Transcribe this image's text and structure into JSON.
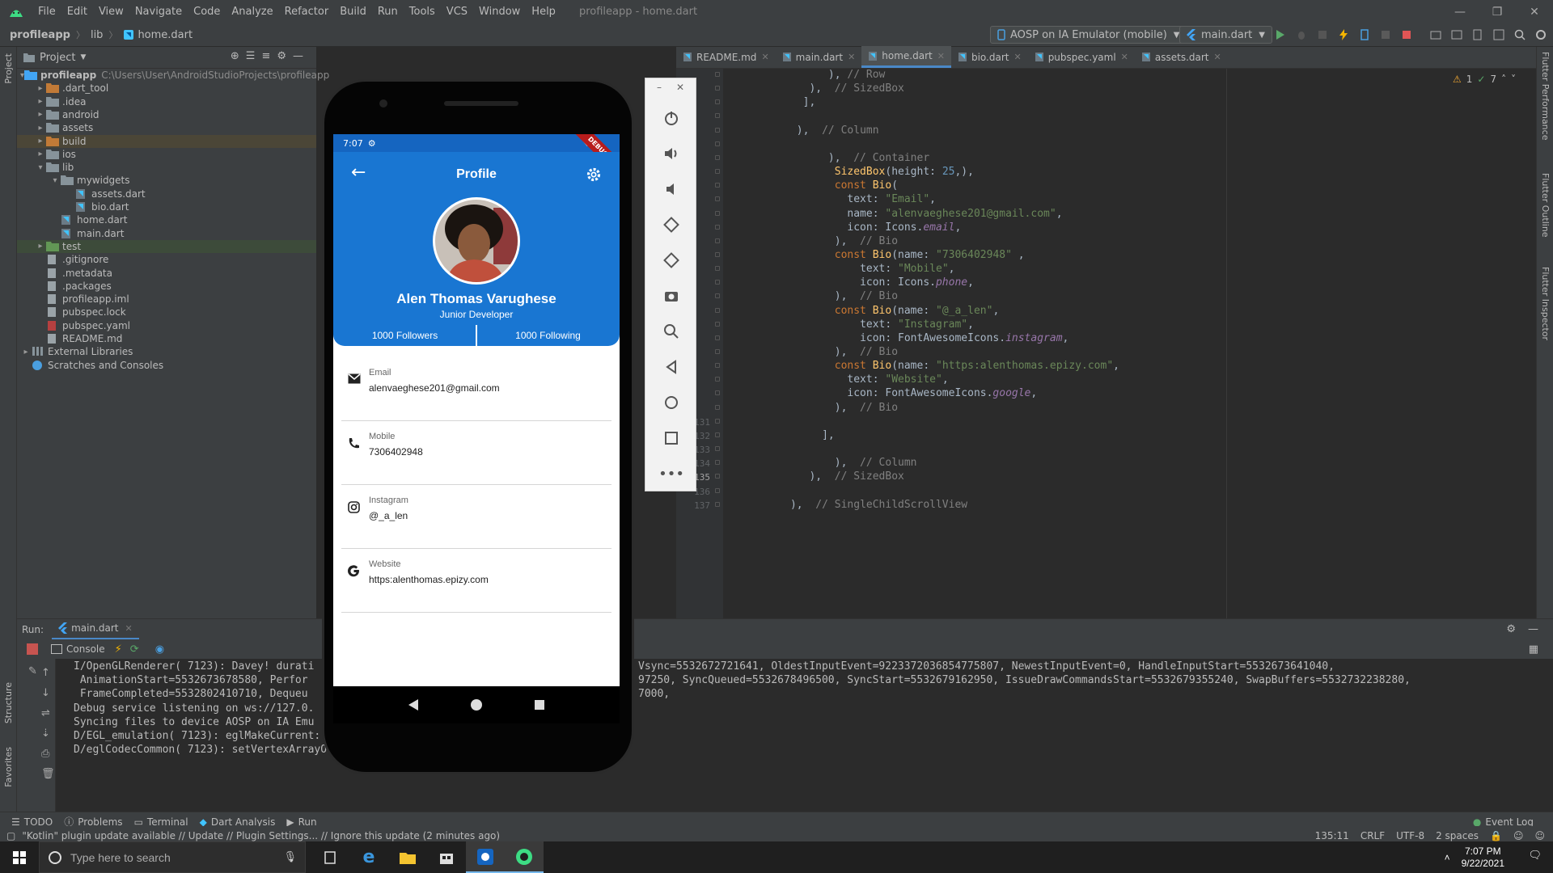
{
  "menu": {
    "items": [
      "File",
      "Edit",
      "View",
      "Navigate",
      "Code",
      "Analyze",
      "Refactor",
      "Build",
      "Run",
      "Tools",
      "VCS",
      "Window",
      "Help"
    ],
    "window_title": "profileapp - home.dart"
  },
  "navbar": {
    "crumbs": [
      "profileapp",
      "lib",
      "home.dart"
    ],
    "device": "AOSP on IA Emulator (mobile)",
    "run_config": "main.dart"
  },
  "project_panel": {
    "title": "Project",
    "tree": [
      {
        "label": "profileapp",
        "extra": "C:\\Users\\User\\AndroidStudioProjects\\profileapp",
        "depth": 0,
        "type": "module",
        "open": true
      },
      {
        "label": ".dart_tool",
        "depth": 1,
        "type": "folder-orange",
        "open": false
      },
      {
        "label": ".idea",
        "depth": 1,
        "type": "folder",
        "open": false
      },
      {
        "label": "android",
        "depth": 1,
        "type": "folder",
        "open": false
      },
      {
        "label": "assets",
        "depth": 1,
        "type": "folder",
        "open": false
      },
      {
        "label": "build",
        "depth": 1,
        "type": "folder-orange",
        "open": false,
        "hl": true
      },
      {
        "label": "ios",
        "depth": 1,
        "type": "folder",
        "open": false
      },
      {
        "label": "lib",
        "depth": 1,
        "type": "folder",
        "open": true
      },
      {
        "label": "mywidgets",
        "depth": 2,
        "type": "folder",
        "open": true
      },
      {
        "label": "assets.dart",
        "depth": 3,
        "type": "dart"
      },
      {
        "label": "bio.dart",
        "depth": 3,
        "type": "dart"
      },
      {
        "label": "home.dart",
        "depth": 2,
        "type": "dart"
      },
      {
        "label": "main.dart",
        "depth": 2,
        "type": "dart"
      },
      {
        "label": "test",
        "depth": 1,
        "type": "folder-green",
        "open": false,
        "sel": true
      },
      {
        "label": ".gitignore",
        "depth": 1,
        "type": "file"
      },
      {
        "label": ".metadata",
        "depth": 1,
        "type": "file"
      },
      {
        "label": ".packages",
        "depth": 1,
        "type": "file"
      },
      {
        "label": "profileapp.iml",
        "depth": 1,
        "type": "file"
      },
      {
        "label": "pubspec.lock",
        "depth": 1,
        "type": "file"
      },
      {
        "label": "pubspec.yaml",
        "depth": 1,
        "type": "file-yaml"
      },
      {
        "label": "README.md",
        "depth": 1,
        "type": "file"
      },
      {
        "label": "External Libraries",
        "depth": 0,
        "type": "lib",
        "open": false
      },
      {
        "label": "Scratches and Consoles",
        "depth": 0,
        "type": "scratch"
      }
    ]
  },
  "tabs": [
    {
      "label": "README.md",
      "active": false
    },
    {
      "label": "main.dart",
      "active": false
    },
    {
      "label": "home.dart",
      "active": true
    },
    {
      "label": "bio.dart",
      "active": false
    },
    {
      "label": "pubspec.yaml",
      "active": false
    },
    {
      "label": "assets.dart",
      "active": false
    }
  ],
  "editor": {
    "inspections": {
      "warnings": "1",
      "ok": "7"
    },
    "line_numbers": [
      "131",
      "132",
      "133",
      "134",
      "135",
      "136",
      "137"
    ],
    "code": [
      [
        [
          "            ",
          "t"
        ],
        [
          "),",
          "t"
        ],
        [
          " // Row",
          "c"
        ]
      ],
      [
        [
          "         ",
          "t"
        ],
        [
          "),",
          "t"
        ],
        [
          "  // SizedBox",
          "c"
        ]
      ],
      [
        [
          "        ",
          "t"
        ],
        [
          "],",
          "t"
        ]
      ],
      [
        [
          "",
          ""
        ]
      ],
      [
        [
          "       ",
          "t"
        ],
        [
          "),",
          "t"
        ],
        [
          "  // Column",
          "c"
        ]
      ],
      [
        [
          "",
          ""
        ]
      ],
      [
        [
          "            ",
          "t"
        ],
        [
          "),",
          "t"
        ],
        [
          "  // Container",
          "c"
        ]
      ],
      [
        [
          "             ",
          "t"
        ],
        [
          "SizedBox",
          "f"
        ],
        [
          "(height: ",
          "t"
        ],
        [
          "25",
          "n"
        ],
        [
          ",),",
          "t"
        ]
      ],
      [
        [
          "             ",
          "t"
        ],
        [
          "const ",
          "k"
        ],
        [
          "Bio",
          "f"
        ],
        [
          "(",
          "t"
        ]
      ],
      [
        [
          "               ",
          "t"
        ],
        [
          "text: ",
          "t"
        ],
        [
          "\"Email\"",
          "s"
        ],
        [
          ",",
          "t"
        ]
      ],
      [
        [
          "               ",
          "t"
        ],
        [
          "name: ",
          "t"
        ],
        [
          "\"alenvaeghese201@gmail.com\"",
          "s"
        ],
        [
          ",",
          "t"
        ]
      ],
      [
        [
          "               ",
          "t"
        ],
        [
          "icon: Icons.",
          "t"
        ],
        [
          "email",
          "it"
        ],
        [
          ",",
          "t"
        ]
      ],
      [
        [
          "             ",
          "t"
        ],
        [
          "),",
          "t"
        ],
        [
          "  // Bio",
          "c"
        ]
      ],
      [
        [
          "             ",
          "t"
        ],
        [
          "const ",
          "k"
        ],
        [
          "Bio",
          "f"
        ],
        [
          "(name: ",
          "t"
        ],
        [
          "\"7306402948\"",
          "s"
        ],
        [
          " ,",
          "t"
        ]
      ],
      [
        [
          "                 ",
          "t"
        ],
        [
          "text: ",
          "t"
        ],
        [
          "\"Mobile\"",
          "s"
        ],
        [
          ",",
          "t"
        ]
      ],
      [
        [
          "                 ",
          "t"
        ],
        [
          "icon: Icons.",
          "t"
        ],
        [
          "phone",
          "it"
        ],
        [
          ",",
          "t"
        ]
      ],
      [
        [
          "             ",
          "t"
        ],
        [
          "),",
          "t"
        ],
        [
          "  // Bio",
          "c"
        ]
      ],
      [
        [
          "             ",
          "t"
        ],
        [
          "const ",
          "k"
        ],
        [
          "Bio",
          "f"
        ],
        [
          "(name: ",
          "t"
        ],
        [
          "\"@_a_len\"",
          "s"
        ],
        [
          ",",
          "t"
        ]
      ],
      [
        [
          "                 ",
          "t"
        ],
        [
          "text: ",
          "t"
        ],
        [
          "\"Instagram\"",
          "s"
        ],
        [
          ",",
          "t"
        ]
      ],
      [
        [
          "                 ",
          "t"
        ],
        [
          "icon: FontAwesomeIcons.",
          "t"
        ],
        [
          "instagram",
          "it"
        ],
        [
          ",",
          "t"
        ]
      ],
      [
        [
          "             ",
          "t"
        ],
        [
          "),",
          "t"
        ],
        [
          "  // Bio",
          "c"
        ]
      ],
      [
        [
          "             ",
          "t"
        ],
        [
          "const ",
          "k"
        ],
        [
          "Bio",
          "f"
        ],
        [
          "(name: ",
          "t"
        ],
        [
          "\"https:alenthomas.epizy.com\"",
          "s"
        ],
        [
          ",",
          "t"
        ]
      ],
      [
        [
          "               ",
          "t"
        ],
        [
          "text: ",
          "t"
        ],
        [
          "\"Website\"",
          "s"
        ],
        [
          ",",
          "t"
        ]
      ],
      [
        [
          "               ",
          "t"
        ],
        [
          "icon: FontAwesomeIcons.",
          "t"
        ],
        [
          "google",
          "it"
        ],
        [
          ",",
          "t"
        ]
      ],
      [
        [
          "             ",
          "t"
        ],
        [
          "),",
          "t"
        ],
        [
          "  // Bio",
          "c"
        ]
      ],
      [
        [
          "",
          ""
        ]
      ],
      [
        [
          "           ",
          "t"
        ],
        [
          "],",
          "t"
        ]
      ],
      [
        [
          "",
          ""
        ]
      ],
      [
        [
          "             ",
          "t"
        ],
        [
          "),",
          "t"
        ],
        [
          "  // Column",
          "c"
        ]
      ],
      [
        [
          "         ",
          "t"
        ],
        [
          "),",
          "t"
        ],
        [
          "  // SizedBox",
          "c"
        ]
      ],
      [
        [
          "",
          ""
        ]
      ],
      [
        [
          "      ",
          "t"
        ],
        [
          "),",
          "t"
        ],
        [
          "  // SingleChildScrollView",
          "c"
        ]
      ]
    ]
  },
  "phone": {
    "status_time": "7:07",
    "debug_banner": "DEBUG",
    "app_title": "Profile",
    "name": "Alen Thomas Varughese",
    "role": "Junior Developer",
    "followers": "1000 Followers",
    "following": "1000 Following",
    "bios": [
      {
        "label": "Email",
        "value": "alenvaeghese201@gmail.com",
        "icon": "mail-icon"
      },
      {
        "label": "Mobile",
        "value": "7306402948",
        "icon": "phone-icon"
      },
      {
        "label": "Instagram",
        "value": "@_a_len",
        "icon": "instagram-icon"
      },
      {
        "label": "Website",
        "value": "https:alenthomas.epizy.com",
        "icon": "google-icon"
      }
    ]
  },
  "run_panel": {
    "label": "Run:",
    "config": "main.dart",
    "console_tab": "Console",
    "lines": [
      "I/OpenGLRenderer( 7123): Davey! durati",
      " AnimationStart=5532673678580, Perfor",
      " FrameCompleted=5532802410710, Dequeu",
      "Debug service listening on ws://127.0.",
      "Syncing files to device AOSP on IA Emu",
      "D/EGL_emulation( 7123): eglMakeCurrent:",
      "D/eglCodecCommon( 7123): setVertexArrayObject: set vao to 0 (0) 1 0"
    ],
    "lines_right": [
      "Vsync=5532672721641, OldestInputEvent=9223372036854775807, NewestInputEvent=0, HandleInputStart=5532673641040,",
      "97250, SyncQueued=5532678496500, SyncStart=5532679162950, IssueDrawCommandsStart=5532679355240, SwapBuffers=5532732238280,",
      "7000,"
    ]
  },
  "bottom_tools": [
    "TODO",
    "Problems",
    "Terminal",
    "Dart Analysis",
    "Run"
  ],
  "event_log": "Event Log",
  "status": {
    "message": "\"Kotlin\" plugin update available // Update // Plugin Settings... // Ignore this update (2 minutes ago)",
    "position": "135:11",
    "line_sep": "CRLF",
    "encoding": "UTF-8",
    "indent": "2 spaces"
  },
  "side_labels": {
    "left_project": "Project",
    "left_structure": "Structure",
    "left_favorites": "Favorites",
    "right_perf": "Flutter Performance",
    "right_outline": "Flutter Outline",
    "right_inspector": "Flutter Inspector"
  },
  "taskbar": {
    "search_placeholder": "Type here to search",
    "time": "7:07 PM",
    "date": "9/22/2021"
  }
}
